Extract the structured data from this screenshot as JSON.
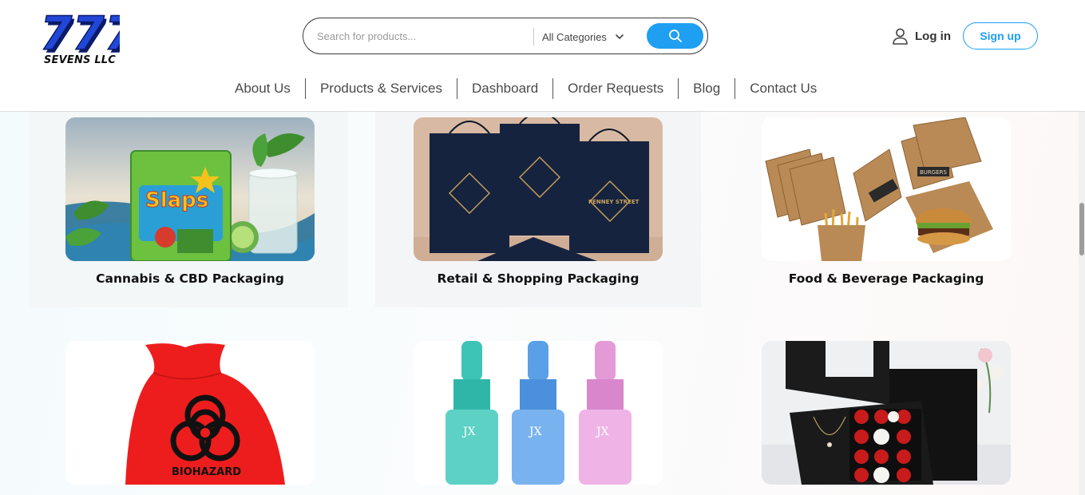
{
  "brand": {
    "name": "SEVENS LLC",
    "logo_numerals": "777",
    "colors": {
      "logo_blue": "#1f3fc6",
      "logo_shadow": "#0b1a6b"
    }
  },
  "search": {
    "placeholder": "Search for products...",
    "category_label": "All Categories"
  },
  "auth": {
    "login_label": "Log in",
    "signup_label": "Sign up"
  },
  "nav": {
    "items": [
      {
        "label": "About Us"
      },
      {
        "label": "Products & Services"
      },
      {
        "label": "Dashboard"
      },
      {
        "label": "Order Requests"
      },
      {
        "label": "Blog"
      },
      {
        "label": "Contact Us"
      }
    ]
  },
  "products": [
    {
      "title": "Cannabis & CBD Packaging",
      "image_text": "Slaps"
    },
    {
      "title": "Retail & Shopping Packaging",
      "image_text": "PENNEY STREET"
    },
    {
      "title": "Food & Beverage Packaging",
      "image_text": "BURGERS"
    },
    {
      "title": "",
      "image_text": "BIOHAZARD"
    },
    {
      "title": "",
      "image_text": "JX"
    },
    {
      "title": ""
    }
  ],
  "theme": {
    "accent": "#1e9ff2",
    "text": "#111111",
    "nav_text": "#4a4a4a"
  }
}
